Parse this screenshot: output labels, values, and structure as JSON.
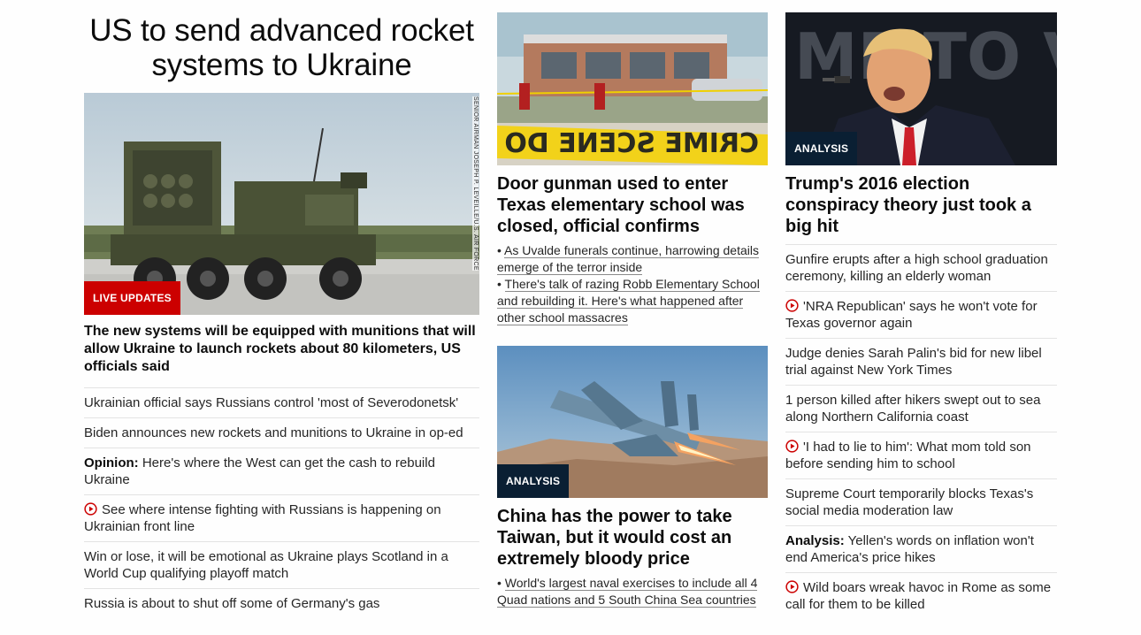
{
  "lead": {
    "headline": "US to send advanced rocket systems to Ukraine",
    "image_label": "LIVE UPDATES",
    "image_credit": "SENIOR AIRMAN JOSEPH P. LEVEILLE/U.S. AIR FORCE",
    "sub_headline": "The new systems will be equipped with munitions that will allow Ukraine to launch rockets about 80 kilometers, US officials said",
    "stories": [
      {
        "prefix": "",
        "text": "Ukrainian official says Russians control 'most of Severodonetsk'",
        "video": false
      },
      {
        "prefix": "",
        "text": "Biden announces new rockets and munitions to Ukraine in op-ed",
        "video": false
      },
      {
        "prefix": "Opinion:",
        "text": " Here's where the West can get the cash to rebuild Ukraine",
        "video": false
      },
      {
        "prefix": "",
        "text": "See where intense fighting with Russians is happening on Ukrainian front line",
        "video": true
      },
      {
        "prefix": "",
        "text": "Win or lose, it will be emotional as Ukraine plays Scotland in a World Cup qualifying playoff match",
        "video": false
      },
      {
        "prefix": "",
        "text": "Russia is about to shut off some of Germany's gas",
        "video": false
      }
    ]
  },
  "middle": {
    "card1": {
      "image_text": "CRIME SCENE DO NO",
      "headline": "Door gunman used to enter Texas elementary school was closed, official confirms",
      "bullets": [
        "As Uvalde funerals continue, harrowing details emerge of the terror inside",
        "There's talk of razing Robb Elementary School and rebuilding it. Here's what happened after other school massacres"
      ]
    },
    "card2": {
      "image_label": "ANALYSIS",
      "headline": "China has the power to take Taiwan, but it would cost an extremely bloody price",
      "bullets": [
        "World's largest naval exercises to include all 4 Quad nations and 5 South China Sea countries"
      ]
    }
  },
  "right": {
    "image_label": "ANALYSIS",
    "image_text": "ME TO V",
    "headline": "Trump's 2016 election conspiracy theory just took a big hit",
    "stories": [
      {
        "prefix": "",
        "text": "Gunfire erupts after a high school graduation ceremony, killing an elderly woman",
        "video": false
      },
      {
        "prefix": "",
        "text": "'NRA Republican' says he won't vote for Texas governor again",
        "video": true
      },
      {
        "prefix": "",
        "text": "Judge denies Sarah Palin's bid for new libel trial against New York Times",
        "video": false
      },
      {
        "prefix": "",
        "text": "1 person killed after hikers swept out to sea along Northern California coast",
        "video": false
      },
      {
        "prefix": "",
        "text": "'I had to lie to him': What mom told son before sending him to school",
        "video": true
      },
      {
        "prefix": "",
        "text": "Supreme Court temporarily blocks Texas's social media moderation law",
        "video": false
      },
      {
        "prefix": "Analysis:",
        "text": " Yellen's words on inflation won't end America's price hikes",
        "video": false
      },
      {
        "prefix": "",
        "text": "Wild boars wreak havoc in Rome as some call for them to be killed",
        "video": true
      }
    ]
  },
  "colors": {
    "live_red": "#cc0000",
    "analysis_navy": "#0a1f33",
    "play_red": "#cc0000",
    "divider": "#e3e3e3"
  }
}
